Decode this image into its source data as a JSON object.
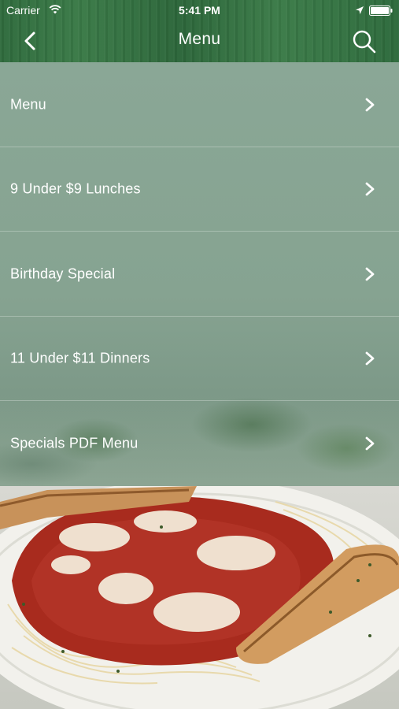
{
  "status_bar": {
    "carrier": "Carrier",
    "time": "5:41 PM"
  },
  "nav": {
    "title": "Menu",
    "back_icon": "chevron-left-icon",
    "search_icon": "search-icon"
  },
  "menu_items": [
    {
      "label": "Menu"
    },
    {
      "label": "9 Under $9 Lunches"
    },
    {
      "label": "Birthday Special"
    },
    {
      "label": "11 Under $11 Dinners"
    },
    {
      "label": "Specials PDF Menu"
    }
  ],
  "colors": {
    "header_green": "#2f6b3d",
    "list_bg": "#86a391",
    "text": "#ffffff"
  }
}
